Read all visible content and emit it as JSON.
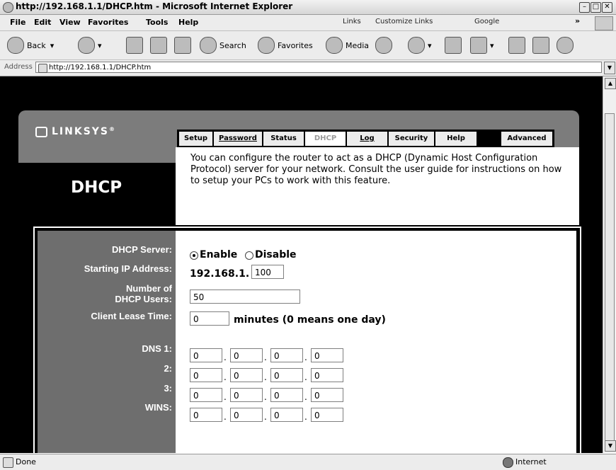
{
  "window": {
    "title": "http://192.168.1.1/DHCP.htm - Microsoft Internet Explorer"
  },
  "menu": {
    "file": "File",
    "edit": "Edit",
    "view": "View",
    "favorites": "Favorites",
    "tools": "Tools",
    "help": "Help",
    "links": "Links",
    "customize_links": "Customize Links",
    "google": "Google",
    "more": "»"
  },
  "toolbar": {
    "back": "Back",
    "search": "Search",
    "favorites": "Favorites",
    "media": "Media"
  },
  "address": {
    "label": "Address",
    "url": "http://192.168.1.1/DHCP.htm"
  },
  "status": {
    "text": "Done",
    "zone": "Internet"
  },
  "router": {
    "logo": "LINKSYS",
    "page_title": "DHCP",
    "tabs": [
      {
        "label": "Setup",
        "active": false,
        "link": false
      },
      {
        "label": "Password",
        "active": false,
        "link": true
      },
      {
        "label": "Status",
        "active": false,
        "link": false
      },
      {
        "label": "DHCP",
        "active": true,
        "link": false
      },
      {
        "label": "Log",
        "active": false,
        "link": true
      },
      {
        "label": "Security",
        "active": false,
        "link": false
      },
      {
        "label": "Help",
        "active": false,
        "link": false
      },
      {
        "label": "Advanced",
        "active": false,
        "link": false
      }
    ],
    "description": "You can configure the router to act as a DHCP (Dynamic Host Configuration Protocol) server for your network. Consult the user guide for instructions on how to setup your PCs to work with this feature."
  },
  "form": {
    "dhcp_server_label": "DHCP Server:",
    "enable_label": "Enable",
    "disable_label": "Disable",
    "dhcp_enabled": true,
    "start_ip_label": "Starting IP Address:",
    "ip_prefix": "192.168.1.",
    "start_ip_last": "100",
    "num_users_label_1": "Number of",
    "num_users_label_2": "DHCP Users:",
    "num_users": "50",
    "lease_label": "Client Lease Time:",
    "lease_value": "0",
    "lease_note": "minutes (0 means one day)",
    "dns1_label": "DNS 1:",
    "dns2_label": "2:",
    "dns3_label": "3:",
    "wins_label": "WINS:",
    "dns1": [
      "0",
      "0",
      "0",
      "0"
    ],
    "dns2": [
      "0",
      "0",
      "0",
      "0"
    ],
    "dns3": [
      "0",
      "0",
      "0",
      "0"
    ],
    "wins": [
      "0",
      "0",
      "0",
      "0"
    ],
    "octet_separator": "."
  }
}
